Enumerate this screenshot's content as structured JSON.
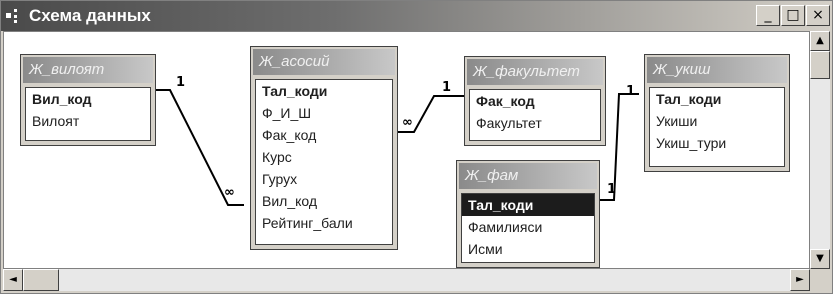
{
  "window": {
    "title": "Схема данных"
  },
  "controls": {
    "minimize": "_",
    "maximize": "□",
    "close": "×"
  },
  "tables": [
    {
      "title": "Ж_вилоят",
      "fields": [
        "Вил_код",
        "Вилоят"
      ]
    },
    {
      "title": "Ж_асосий",
      "fields": [
        "Тал_коди",
        "Ф_И_Ш",
        "Фак_код",
        "Курс",
        "Гурух",
        "Вил_код",
        "Рейтинг_бали"
      ]
    },
    {
      "title": "Ж_факультет",
      "fields": [
        "Фак_код",
        "Факультет"
      ]
    },
    {
      "title": "Ж_фам",
      "fields": [
        "Тал_коди",
        "Фамилияси",
        "Исми"
      ]
    },
    {
      "title": "Ж_укиш",
      "fields": [
        "Тал_коди",
        "Укиши",
        "Укиш_тури"
      ]
    }
  ],
  "relations": {
    "one": "1",
    "many": "∞"
  },
  "scroll": {
    "up": "▲",
    "down": "▼",
    "left": "◄",
    "right": "►"
  }
}
